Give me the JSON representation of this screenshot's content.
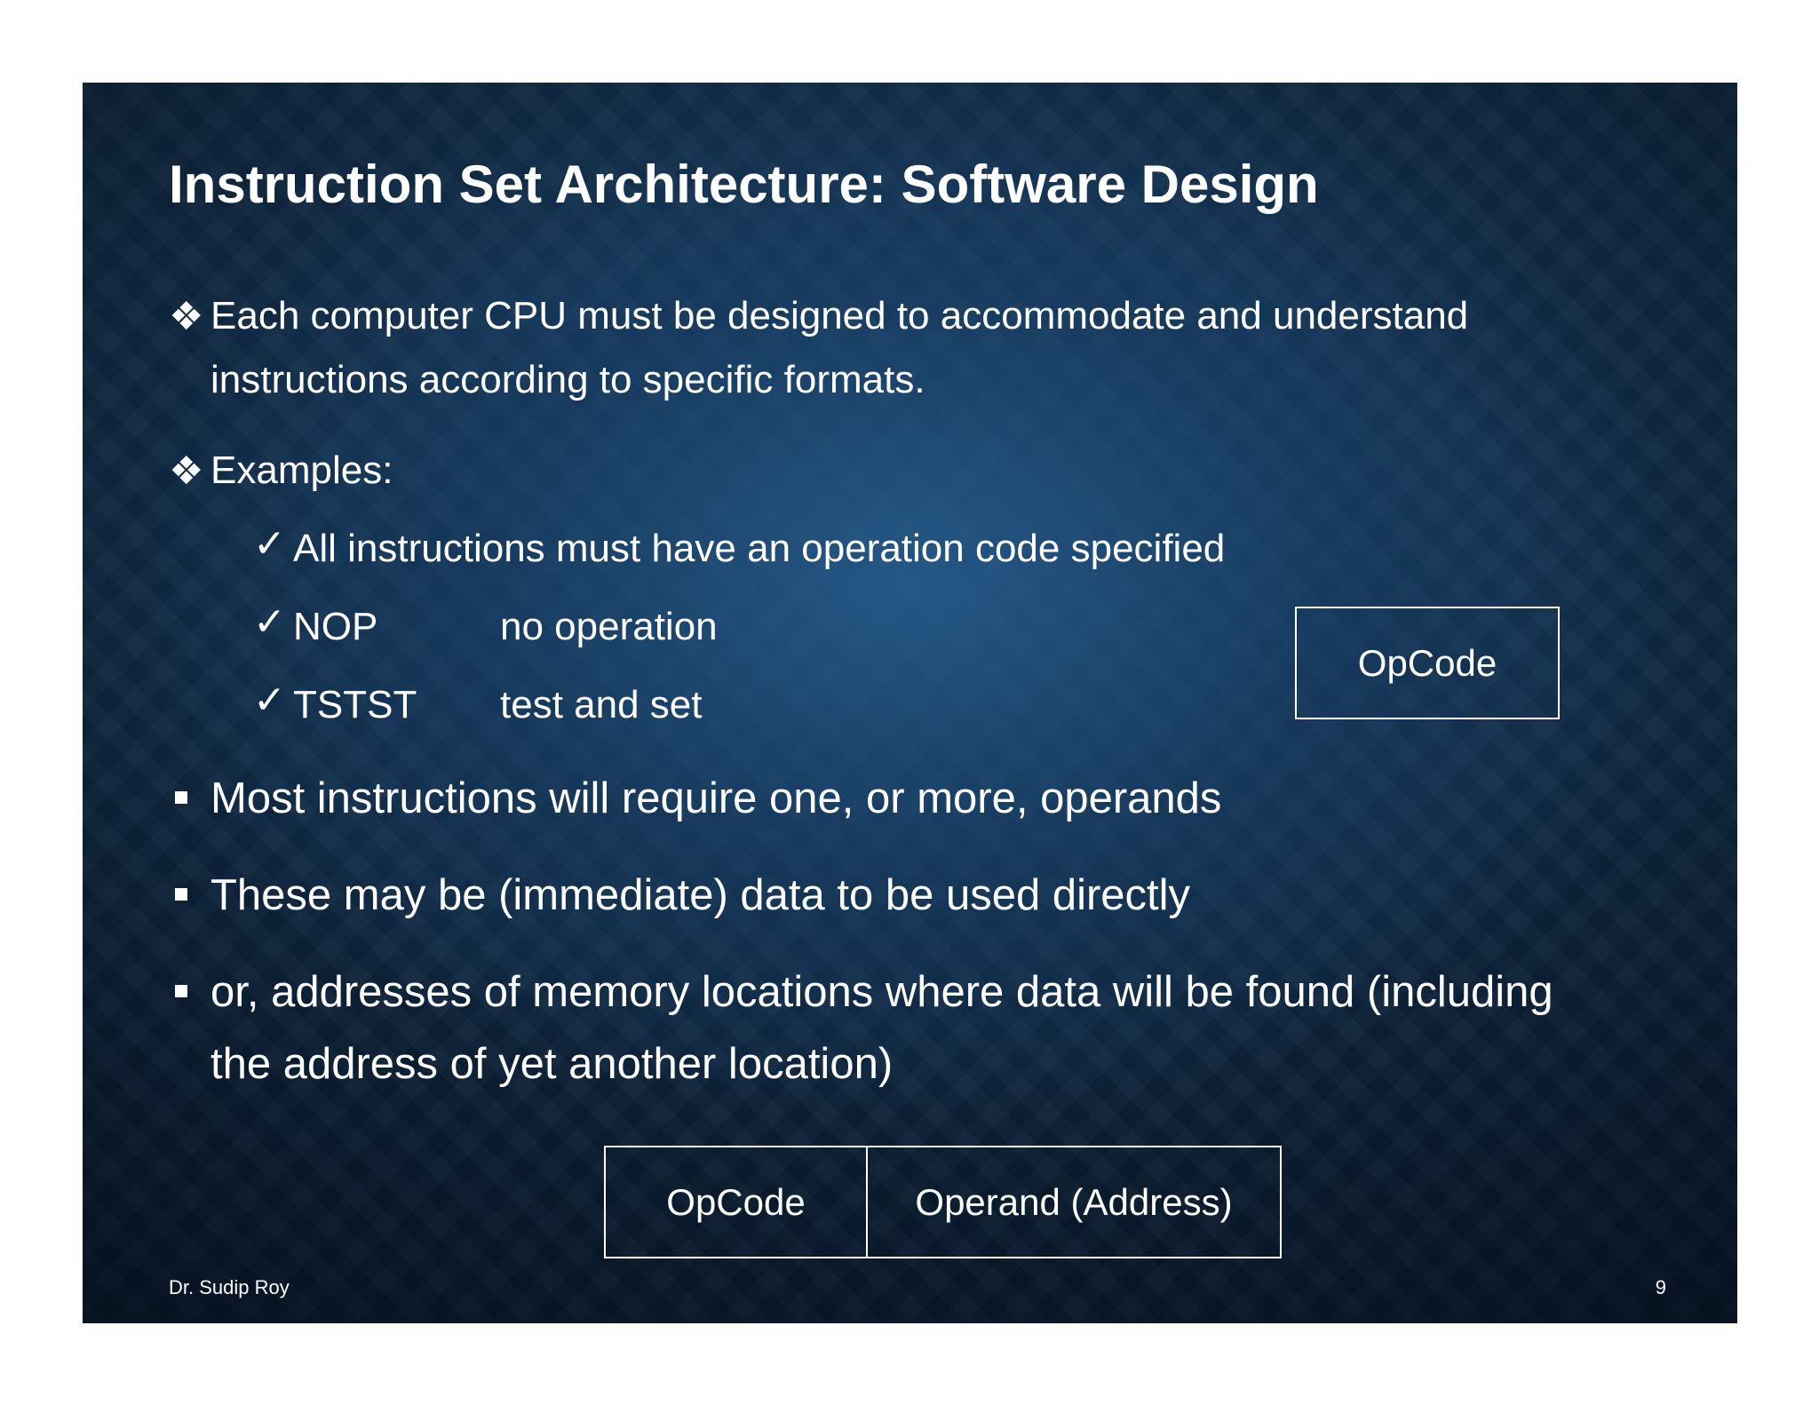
{
  "slide": {
    "title": "Instruction Set Architecture: Software Design",
    "bullets": [
      {
        "marker": "❖",
        "line1": "Each computer CPU must be designed to accommodate and understand",
        "line2": "instructions according to specific formats."
      },
      {
        "marker": "❖",
        "line1": "Examples:"
      }
    ],
    "checks": [
      {
        "marker": "✓",
        "text": "All instructions must have an operation code specified"
      },
      {
        "marker": "✓",
        "code": "NOP",
        "desc": "no operation"
      },
      {
        "marker": "✓",
        "code": "TSTST",
        "desc": "test and set"
      }
    ],
    "opcode_box": "OpCode",
    "square_bullets": [
      {
        "line1": "Most instructions will require one, or more, operands"
      },
      {
        "line1": "These may be (immediate) data to be used directly"
      },
      {
        "line1": "or, addresses of memory locations where data will be found (including",
        "line2": "the address of yet another location)"
      }
    ],
    "format_boxes": [
      "OpCode",
      "Operand (Address)"
    ],
    "footer": {
      "author": "Dr. Sudip Roy",
      "page_number": "9"
    }
  }
}
